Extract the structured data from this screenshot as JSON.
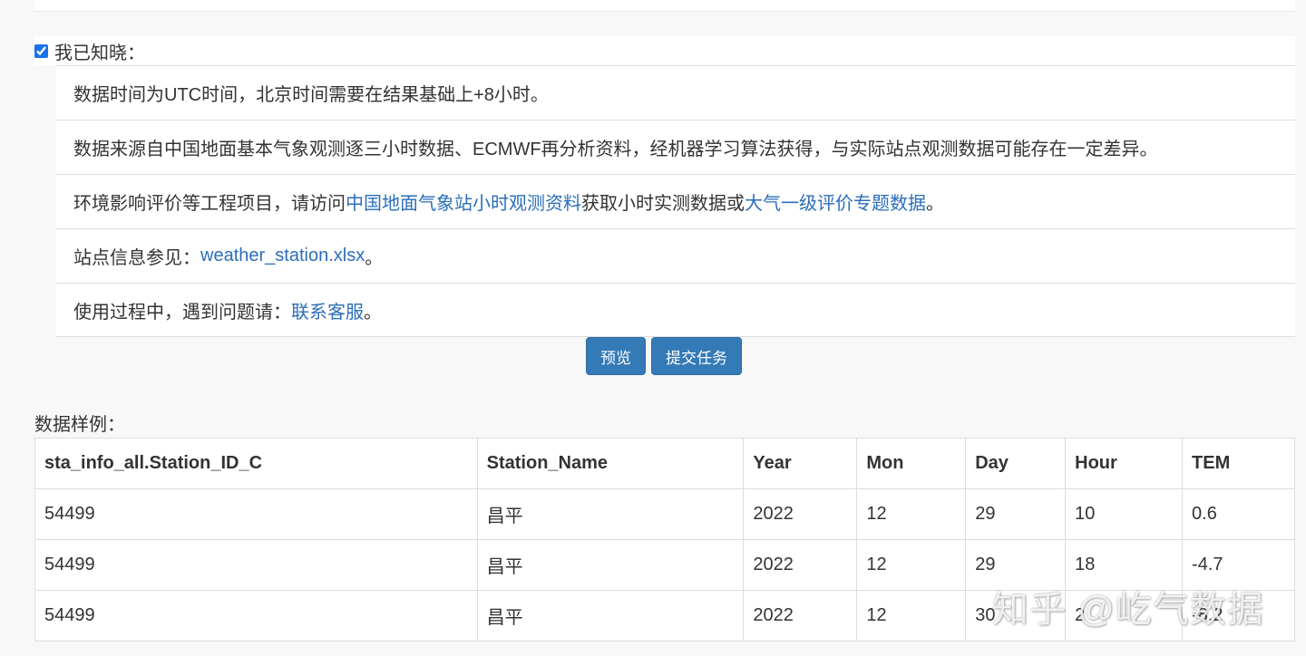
{
  "acknowledge": {
    "label": "我已知晓：",
    "checked": true
  },
  "notices": [
    {
      "text": "数据时间为UTC时间，北京时间需要在结果基础上+8小时。"
    },
    {
      "text": "数据来源自中国地面基本气象观测逐三小时数据、ECMWF再分析资料，经机器学习算法获得，与实际站点观测数据可能存在一定差异。"
    },
    {
      "prefix": "环境影响评价等工程项目，请访问",
      "link1": "中国地面气象站小时观测资料",
      "middle": "获取小时实测数据或",
      "link2": "大气一级评价专题数据",
      "suffix": "。"
    },
    {
      "prefix": "站点信息参见：",
      "link": "weather_station.xlsx",
      "suffix": "。"
    },
    {
      "prefix": "使用过程中，遇到问题请：",
      "link": "联系客服",
      "suffix": "。"
    }
  ],
  "buttons": {
    "preview": "预览",
    "submit": "提交任务"
  },
  "sample": {
    "title": "数据样例：",
    "columns": [
      "sta_info_all.Station_ID_C",
      "Station_Name",
      "Year",
      "Mon",
      "Day",
      "Hour",
      "TEM"
    ],
    "rows": [
      [
        "54499",
        "昌平",
        "2022",
        "12",
        "29",
        "10",
        "0.6"
      ],
      [
        "54499",
        "昌平",
        "2022",
        "12",
        "29",
        "18",
        "-4.7"
      ],
      [
        "54499",
        "昌平",
        "2022",
        "12",
        "30",
        "2",
        "-8.2"
      ]
    ]
  },
  "watermark": "知乎 @屹气数据",
  "colors": {
    "link": "#2a6ebb",
    "button": "#337ab7",
    "checkbox": "#1a73e8"
  }
}
